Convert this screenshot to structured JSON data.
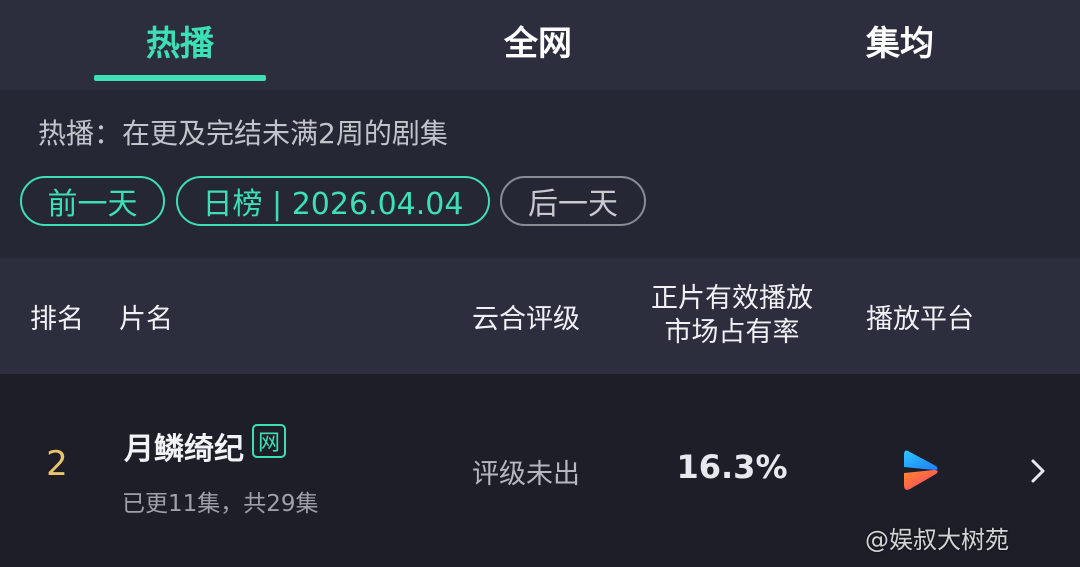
{
  "tabs": [
    {
      "label": "热播",
      "active": true
    },
    {
      "label": "全网",
      "active": false
    },
    {
      "label": "集均",
      "active": false
    }
  ],
  "info": {
    "description": "热播：在更及完结未满2周的剧集",
    "prev_day": "前一天",
    "date_selector": "日榜 | 2026.04.04",
    "next_day": "后一天"
  },
  "table": {
    "headers": {
      "rank": "排名",
      "title": "片名",
      "rating": "云合评级",
      "share_line1": "正片有效播放",
      "share_line2": "市场占有率",
      "platform": "播放平台"
    },
    "rows": [
      {
        "rank": "2",
        "title": "月鳞绮纪",
        "badge": "网",
        "episodes": "已更11集，共29集",
        "rating": "评级未出",
        "share": "16.3%",
        "platform_icon": "youku-play-icon"
      }
    ]
  },
  "watermark": "@娱叔大树苑",
  "colors": {
    "accent": "#3de0b4",
    "rank": "#e9c46a",
    "background": "#1d1e28"
  }
}
